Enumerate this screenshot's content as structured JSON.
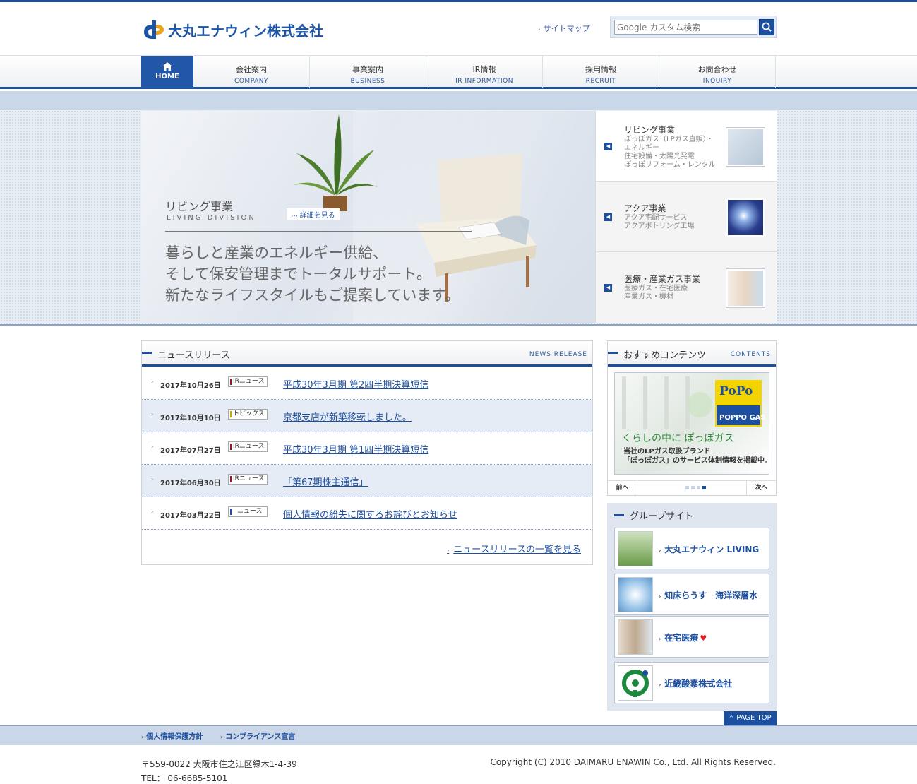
{
  "header": {
    "logo_text": "大丸エナウィン株式会社",
    "sitemap_label": "サイトマップ",
    "search_placeholder": "Google カスタム検索"
  },
  "nav": {
    "home": "HOME",
    "items": [
      {
        "jp": "会社案内",
        "en": "COMPANY"
      },
      {
        "jp": "事業案内",
        "en": "BUSINESS"
      },
      {
        "jp": "IR情報",
        "en": "IR INFORMATION"
      },
      {
        "jp": "採用情報",
        "en": "RECRUIT"
      },
      {
        "jp": "お問合わせ",
        "en": "INQUIRY"
      }
    ]
  },
  "hero": {
    "title": "リビング事業",
    "subtitle": "LIVING DIVISION",
    "more_label": "詳細を見る",
    "copy": [
      "暮らしと産業のエネルギー供給、",
      "そして保安管理までトータルサポート。",
      "新たなライフスタイルもご提案しています。"
    ]
  },
  "side": [
    {
      "title": "リビング事業",
      "lines": [
        "ぽっぽガス（LPガス直販）・",
        "エネルギー",
        "住宅設備・太陽光発電",
        "ぽっぽリフォーム・レンタル"
      ]
    },
    {
      "title": "アクア事業",
      "lines": [
        "アクア宅配サービス",
        "アクアボトリング工場"
      ]
    },
    {
      "title": "医療・産業ガス事業",
      "lines": [
        "医療ガス・在宅医療",
        "産業ガス・機材"
      ]
    }
  ],
  "news": {
    "title": "ニュースリリース",
    "title_en": "NEWS RELEASE",
    "rows": [
      {
        "date": "2017年10月26日",
        "badge": "IRニュース",
        "title": "平成30年3月期 第2四半期決算短信"
      },
      {
        "date": "2017年10月10日",
        "badge": "トピックス",
        "title": "京都支店が新築移転しました。"
      },
      {
        "date": "2017年07月27日",
        "badge": "IRニュース",
        "title": "平成30年3月期 第1四半期決算短信"
      },
      {
        "date": "2017年06月30日",
        "badge": "IRニュース",
        "title": "「第67期株主通信」"
      },
      {
        "date": "2017年03月22日",
        "badge": "ニュース",
        "title": "個人情報の紛失に関するお詫びとお知らせ"
      }
    ],
    "more_label": "ニュースリリースの一覧を見る"
  },
  "contents": {
    "title": "おすすめコンテンツ",
    "title_en": "CONTENTS",
    "promo_logo": "PoPo",
    "promo_logo_sub": "POPPO GAS",
    "promo_catch": "くらしの中に ぽっぽガス",
    "promo_desc": [
      "当社のLPガス取扱ブランド",
      "「ぽっぽガス」のサービス体制情報を掲載中。"
    ],
    "prev": "前へ",
    "next": "次へ"
  },
  "group": {
    "title": "グループサイト",
    "items": [
      "大丸エナウィン LIVING",
      "知床らうす　海洋深層水",
      "在宅医療",
      "近畿酸素株式会社"
    ]
  },
  "pagetop": "PAGE TOP",
  "footer": {
    "links": [
      "個人情報保護方針",
      "コンプライアンス宣言"
    ],
    "address": "〒559-0022 大阪市住之江区緑木1-4-39",
    "tel": "TEL： 06-6685-5101",
    "copyright": "Copyright (C) 2010 DAIMARU ENAWIN Co., Ltd. All Rights Reserved."
  },
  "colors": {
    "brand": "#1d4fa0",
    "band": "#c9d7e8"
  }
}
